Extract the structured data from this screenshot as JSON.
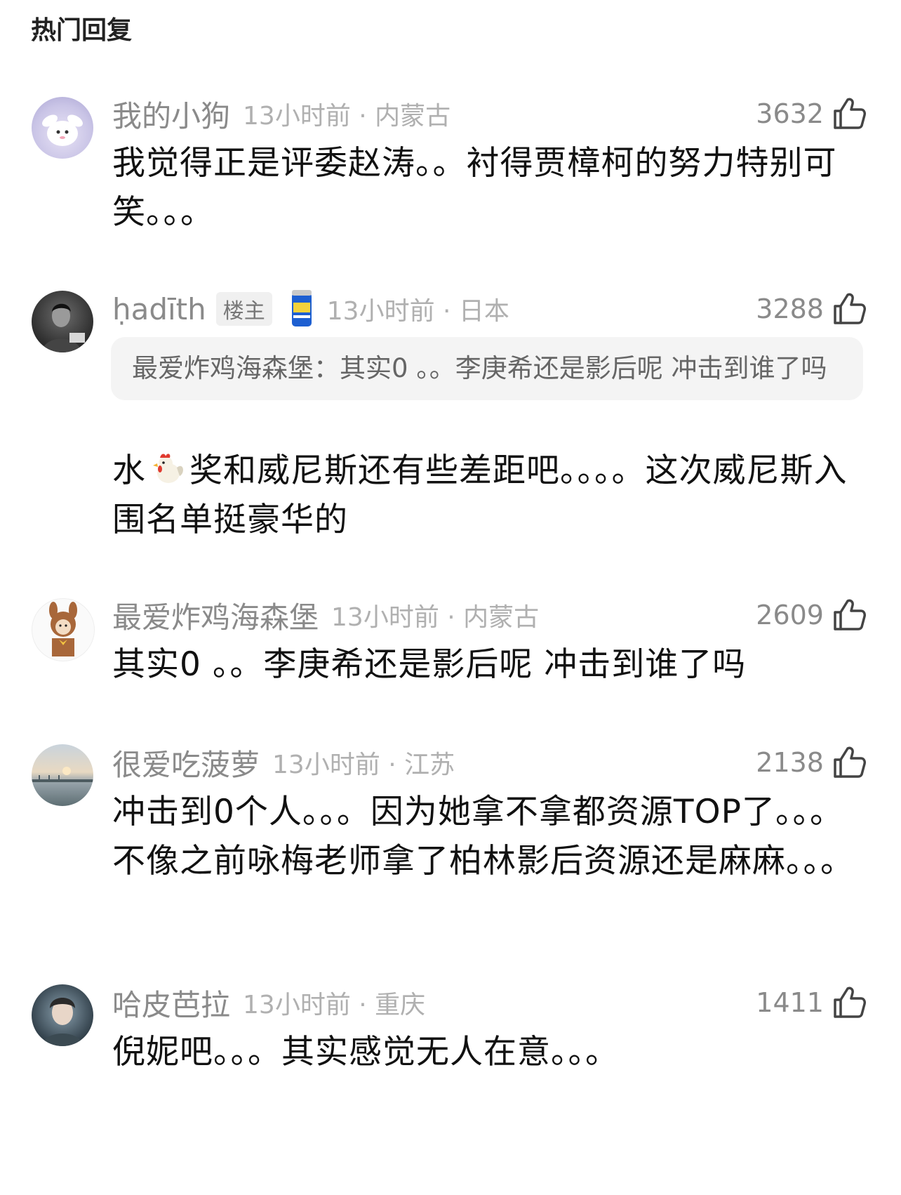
{
  "section_title": "热门回复",
  "comments": [
    {
      "username": "我的小狗",
      "time_location": "13小时前 · 内蒙古",
      "likes": "3632",
      "text": "我觉得正是评委赵涛。。衬得贾樟柯的努力特别可笑。。。",
      "avatar_icon": "bunny-avatar-icon"
    },
    {
      "username": "ḥadīth",
      "op_badge": "楼主",
      "time_location": "13小时前 · 日本",
      "likes": "3288",
      "quote": "最爱炸鸡海森堡：其实0 。。李庚希还是影后呢 冲击到谁了吗",
      "text_before_emoji": "水",
      "inline_emoji": "rooster-emoji-icon",
      "text_after_emoji": "奖和威尼斯还有些差距吧。。。。这次威尼斯入围名单挺豪华的",
      "avatar_icon": "portrait-avatar-icon",
      "badge_icon": "beer-can-badge-icon"
    },
    {
      "username": "最爱炸鸡海森堡",
      "time_location": "13小时前 · 内蒙古",
      "likes": "2609",
      "text": "其实0 。。李庚希还是影后呢 冲击到谁了吗",
      "avatar_icon": "bear-costume-avatar-icon"
    },
    {
      "username": "很爱吃菠萝",
      "time_location": "13小时前 · 江苏",
      "likes": "2138",
      "text": "冲击到0个人。。。因为她拿不拿都资源TOP了。。。不像之前咏梅老师拿了柏林影后资源还是麻麻。。。",
      "avatar_icon": "sunset-landscape-avatar-icon"
    },
    {
      "username": "哈皮芭拉",
      "time_location": "13小时前 · 重庆",
      "likes": "1411",
      "text": "倪妮吧。。。其实感觉无人在意。。。",
      "avatar_icon": "portrait-avatar-icon"
    }
  ],
  "colors": {
    "username": "#8a8a8a",
    "time": "#b0b0b0",
    "body_text": "#111111",
    "quote_bg": "#f4f4f4"
  }
}
